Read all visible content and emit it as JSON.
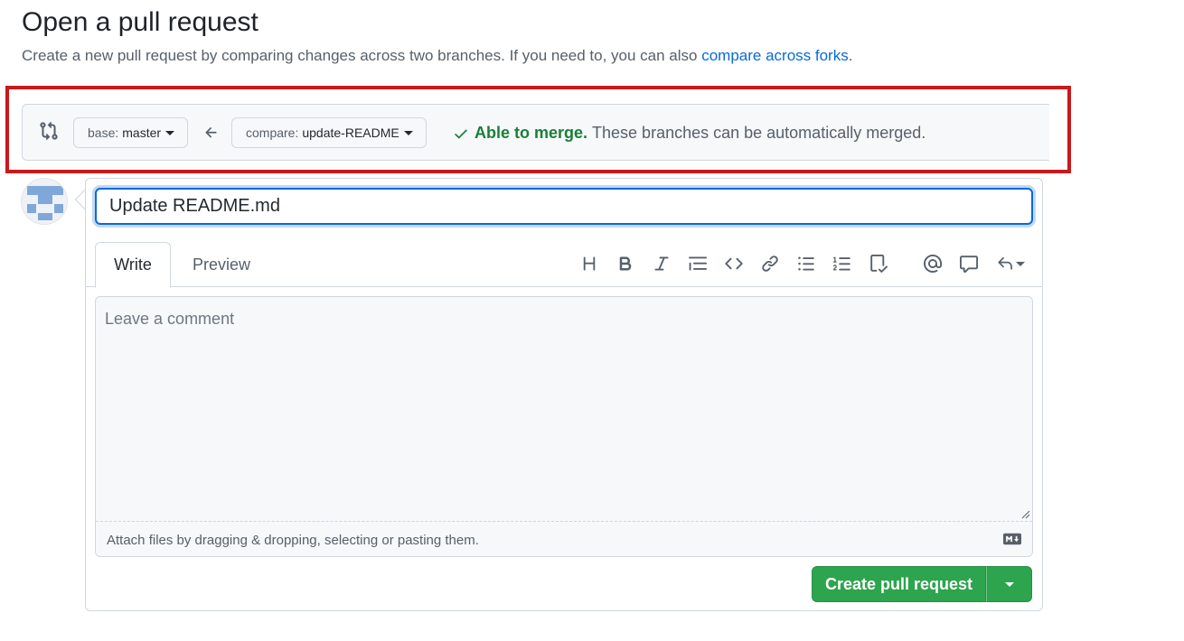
{
  "header": {
    "title": "Open a pull request",
    "description": "Create a new pull request by comparing changes across two branches. If you need to, you can also ",
    "link_text": "compare across forks",
    "period": "."
  },
  "range": {
    "base_prefix": "base:",
    "base_branch": "master",
    "compare_prefix": "compare:",
    "compare_branch": "update-README",
    "merge_status": "Able to merge.",
    "merge_detail": "These branches can be automatically merged."
  },
  "form": {
    "title_value": "Update README.md",
    "tabs": [
      "Write",
      "Preview"
    ],
    "comment_placeholder": "Leave a comment",
    "attach_text": "Attach files by dragging & dropping, selecting or pasting them.",
    "submit_label": "Create pull request"
  },
  "toolbar_icons": [
    "heading-icon",
    "bold-icon",
    "italic-icon",
    "quote-icon",
    "code-icon",
    "link-icon",
    "unordered-list-icon",
    "ordered-list-icon",
    "task-list-icon",
    "mention-icon",
    "reference-icon",
    "saved-replies-icon"
  ],
  "colors": {
    "link": "#0969da",
    "success": "#1a7f37",
    "submit": "#2da44e",
    "highlight": "#c8191c",
    "focus": "#0969da"
  }
}
